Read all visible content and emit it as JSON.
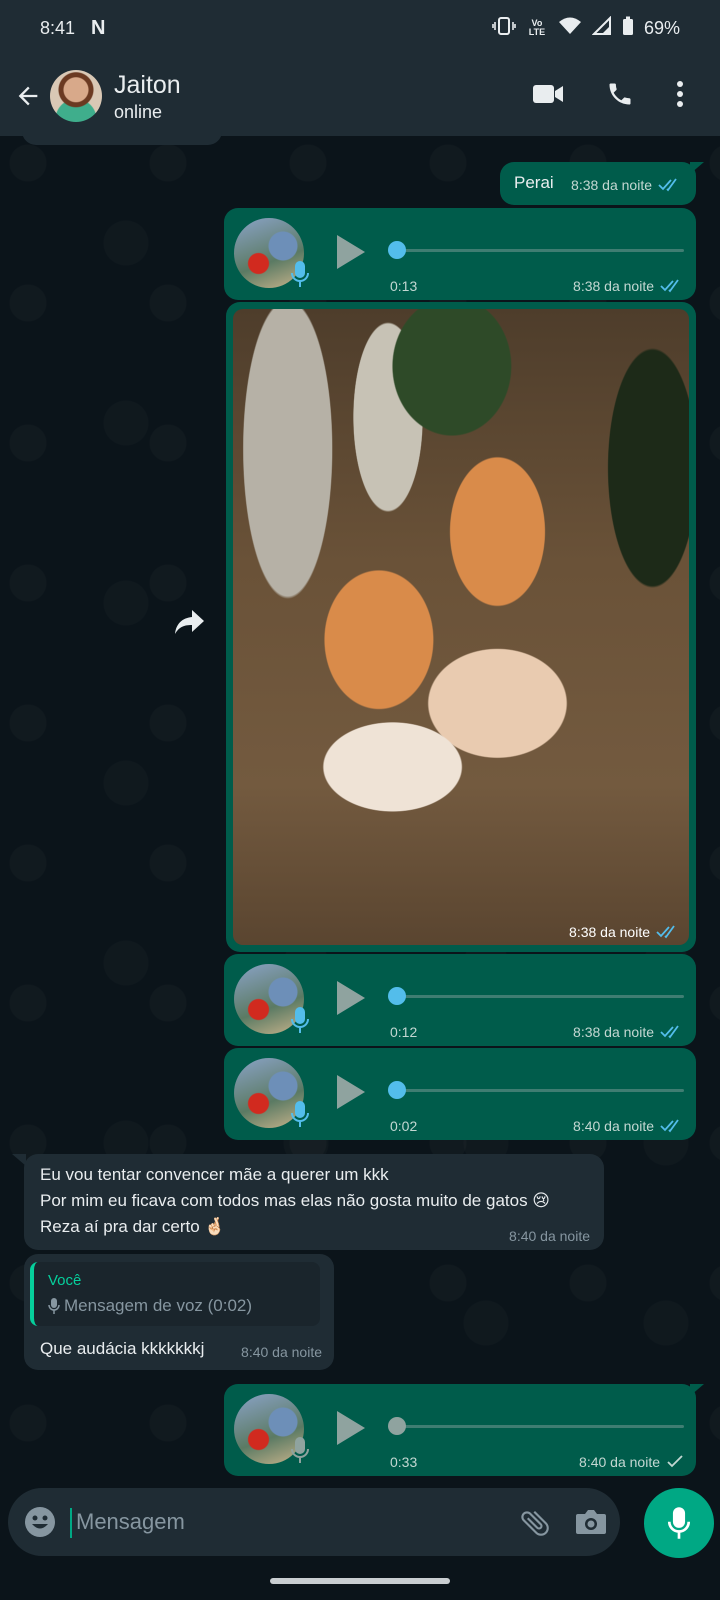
{
  "status_bar": {
    "time": "8:41",
    "app_badge": "N",
    "volte": "Vo LTE",
    "battery": "69%"
  },
  "header": {
    "contact_name": "Jaiton",
    "contact_status": "online"
  },
  "colors": {
    "outgoing_bubble": "#005c4b",
    "incoming_bubble": "#1f2c34",
    "accent": "#00a884",
    "read_ticks": "#53bdeb"
  },
  "messages": [
    {
      "type": "text",
      "direction": "out",
      "text": "Perai",
      "time": "8:38 da noite",
      "status": "read"
    },
    {
      "type": "voice",
      "direction": "out",
      "duration": "0:13",
      "time": "8:38 da noite",
      "status": "read"
    },
    {
      "type": "image",
      "direction": "out",
      "time": "8:38 da noite",
      "status": "read"
    },
    {
      "type": "voice",
      "direction": "out",
      "duration": "0:12",
      "time": "8:38 da noite",
      "status": "read"
    },
    {
      "type": "voice",
      "direction": "out",
      "duration": "0:02",
      "time": "8:40 da noite",
      "status": "read"
    },
    {
      "type": "text",
      "direction": "in",
      "lines": [
        "Eu vou tentar convencer mãe a querer um kkk",
        "Por mim eu ficava com todos mas elas não gosta muito de gatos 😢",
        "Reza aí pra dar certo 🤞🏻"
      ],
      "time": "8:40 da noite"
    },
    {
      "type": "reply",
      "direction": "in",
      "quoted_author": "Você",
      "quoted_text": "Mensagem de voz (0:02)",
      "text": "Que audácia kkkkkkkj",
      "time": "8:40 da noite"
    },
    {
      "type": "voice",
      "direction": "out",
      "duration": "0:33",
      "time": "8:40 da noite",
      "status": "sent"
    }
  ],
  "composer": {
    "placeholder": "Mensagem"
  }
}
